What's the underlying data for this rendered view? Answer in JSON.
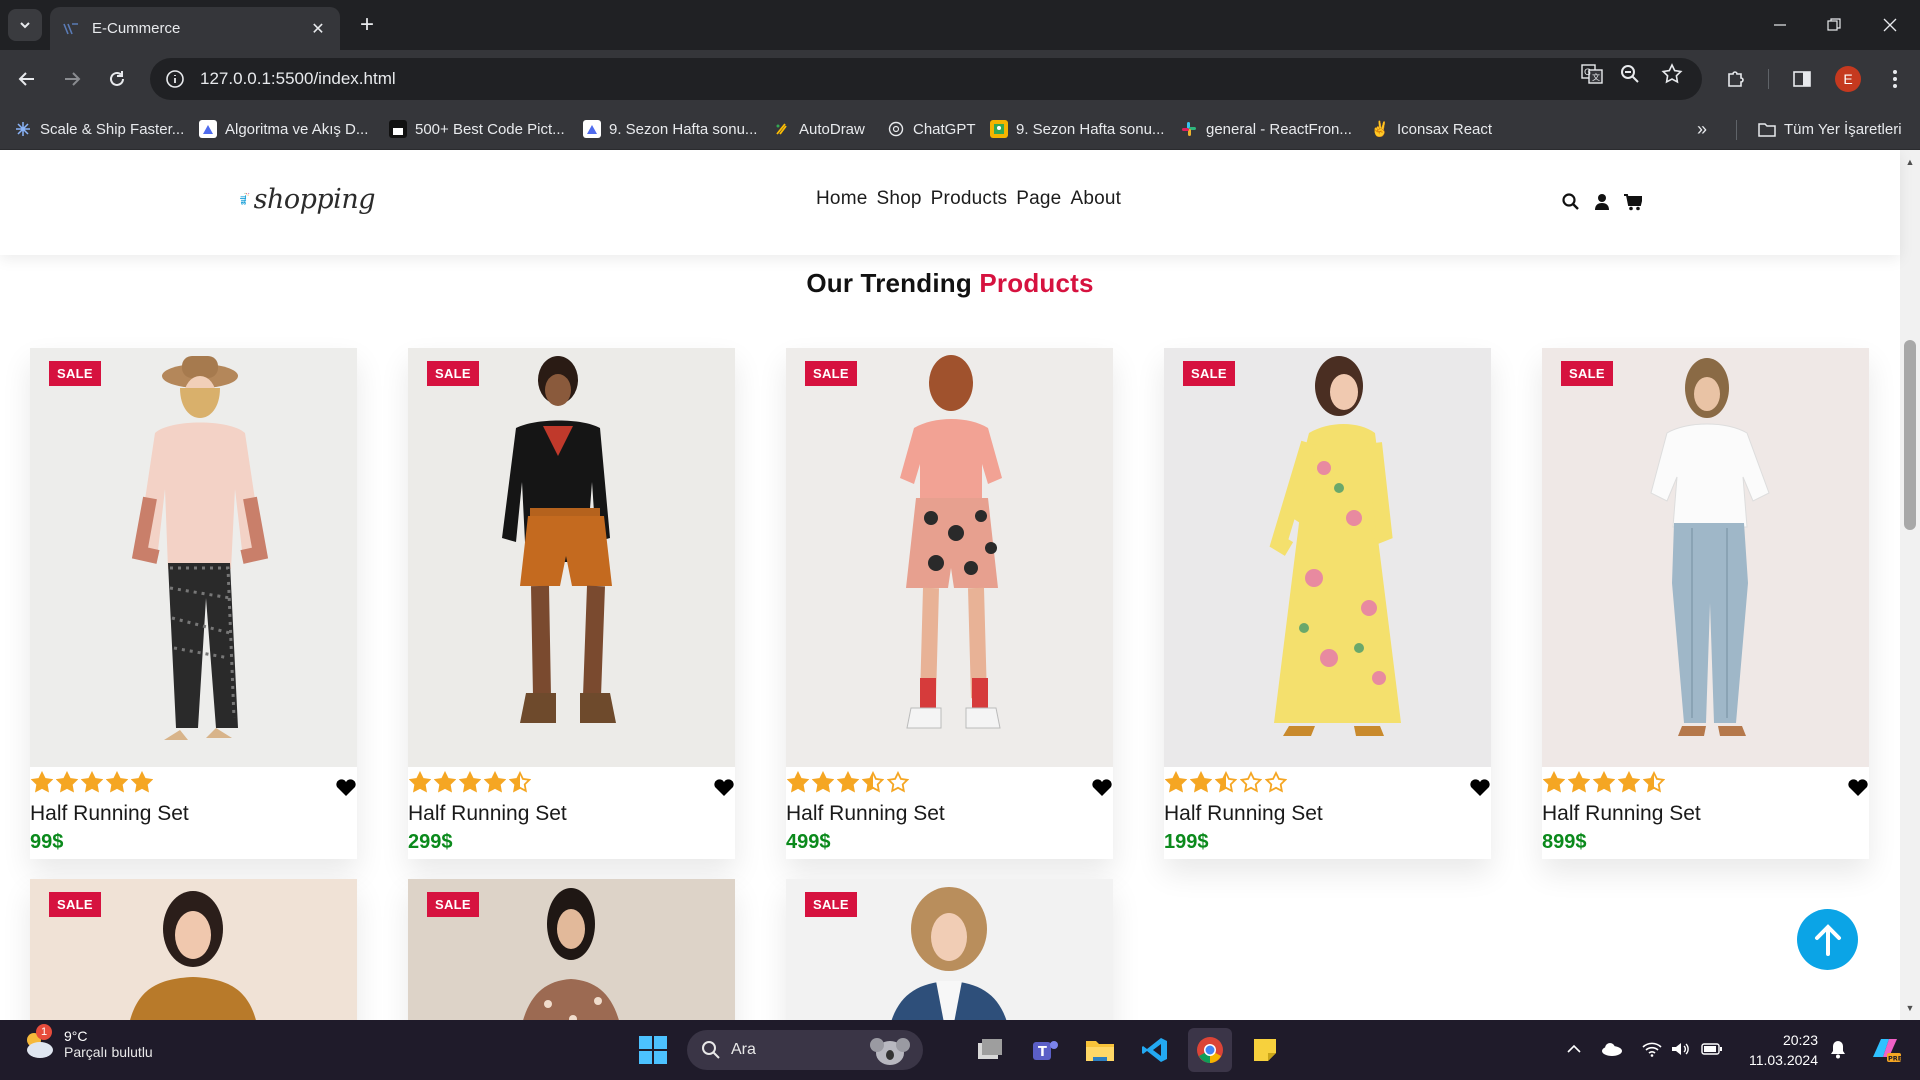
{
  "browser": {
    "tab_title": "E-Cummerce",
    "url": "127.0.0.1:5500/index.html",
    "bookmarks": [
      {
        "label": "Scale & Ship Faster...",
        "icon": "sparkle-icon",
        "color": "#8ab4f8"
      },
      {
        "label": "Algoritma ve Akış D...",
        "icon": "doc-icon",
        "color": "#4f6bed"
      },
      {
        "label": "500+ Best Code Pict...",
        "icon": "code-icon",
        "color": "#111111"
      },
      {
        "label": "9. Sezon Hafta sonu...",
        "icon": "doc-icon",
        "color": "#4f6bed"
      },
      {
        "label": "AutoDraw",
        "icon": "pen-icon",
        "color": "#fbbc04"
      },
      {
        "label": "ChatGPT",
        "icon": "chatgpt-icon",
        "color": "#10a37f"
      },
      {
        "label": "9. Sezon Hafta sonu...",
        "icon": "image-icon",
        "color": "#f4b400"
      },
      {
        "label": "general - ReactFron...",
        "icon": "slack-icon",
        "color": "#e01e5a"
      },
      {
        "label": "Iconsax React",
        "icon": "victory-hand-icon",
        "color": "#f4b400"
      }
    ],
    "all_bookmarks_label": "Tüm Yer İşaretleri",
    "profile_initial": "E"
  },
  "site": {
    "logo_text": "shopping",
    "menu": [
      "Home",
      "Shop",
      "Products",
      "Page",
      "About"
    ],
    "section_title_main": "Our Trending ",
    "section_title_accent": "Products",
    "sale_label": "SALE",
    "colors": {
      "accent": "#d6123f",
      "price": "#0b8a1c",
      "star": "#f5a623",
      "back_to_top": "#0ba4e6"
    }
  },
  "products": [
    {
      "name": "Half Running Set",
      "price": "99$",
      "rating": 5
    },
    {
      "name": "Half Running Set",
      "price": "299$",
      "rating": 4.5
    },
    {
      "name": "Half Running Set",
      "price": "499$",
      "rating": 3.5
    },
    {
      "name": "Half Running Set",
      "price": "199$",
      "rating": 2.5
    },
    {
      "name": "Half Running Set",
      "price": "899$",
      "rating": 4.5
    }
  ],
  "taskbar": {
    "weather_temp": "9°C",
    "weather_cond": "Parçalı bulutlu",
    "weather_badge": "1",
    "search_placeholder": "Ara",
    "time": "20:23",
    "date": "11.03.2024"
  }
}
